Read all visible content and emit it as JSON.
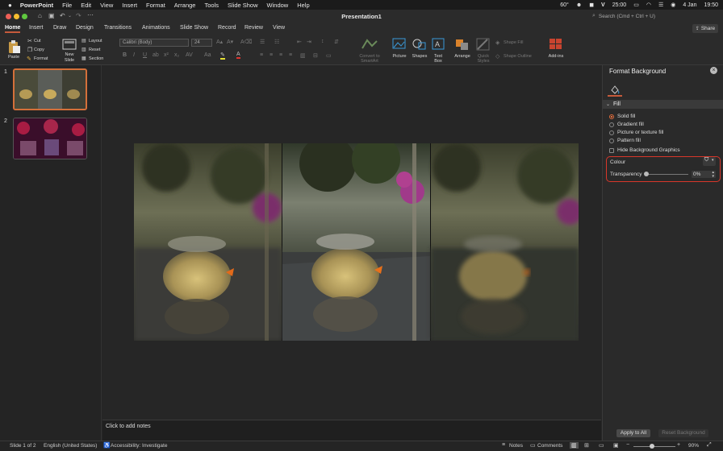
{
  "menubar": {
    "app_name": "PowerPoint",
    "items": [
      "File",
      "Edit",
      "View",
      "Insert",
      "Format",
      "Arrange",
      "Tools",
      "Slide Show",
      "Window",
      "Help"
    ],
    "temperature": "60°",
    "battery": "25:00",
    "date": "4 Jan",
    "time": "19:50"
  },
  "titlebar": {
    "doc_title": "Presentation1",
    "search_placeholder": "Search (Cmd + Ctrl + U)"
  },
  "tabs": [
    "Home",
    "Insert",
    "Draw",
    "Design",
    "Transitions",
    "Animations",
    "Slide Show",
    "Record",
    "Review",
    "View"
  ],
  "active_tab": "Home",
  "share_label": "Share",
  "ribbon": {
    "paste": "Paste",
    "cut": "Cut",
    "copy": "Copy",
    "format": "Format",
    "new_slide_1": "New",
    "new_slide_2": "Slide",
    "layout": "Layout",
    "reset": "Reset",
    "section": "Section",
    "font_name": "Calibri (Body)",
    "font_size": "24",
    "convert_1": "Convert to",
    "convert_2": "SmartArt",
    "picture": "Picture",
    "shapes": "Shapes",
    "textbox_1": "Text",
    "textbox_2": "Box",
    "arrange": "Arrange",
    "quick_1": "Quick",
    "quick_2": "Styles",
    "shape_fill": "Shape Fill",
    "shape_outline": "Shape Outline",
    "addins": "Add-ins"
  },
  "slides": [
    {
      "number": "1"
    },
    {
      "number": "2"
    }
  ],
  "notes_placeholder": "Click to add notes",
  "format_pane": {
    "title": "Format Background",
    "section": "Fill",
    "options": [
      "Solid fill",
      "Gradient fill",
      "Picture or texture fill",
      "Pattern fill"
    ],
    "selected_option": "Solid fill",
    "hide_bg": "Hide Background Graphics",
    "colour_label": "Colour",
    "transparency_label": "Transparency",
    "transparency_value": "0%",
    "apply_all": "Apply to All",
    "reset_bg": "Reset Background"
  },
  "status": {
    "slide_of": "Slide 1 of 2",
    "language": "English (United States)",
    "accessibility": "Accessibility: Investigate",
    "notes": "Notes",
    "comments": "Comments",
    "zoom": "90%"
  },
  "colors": {
    "accent": "#c55a3b",
    "highlight_box": "#d9372a",
    "radio_on": "#e06c3c"
  }
}
